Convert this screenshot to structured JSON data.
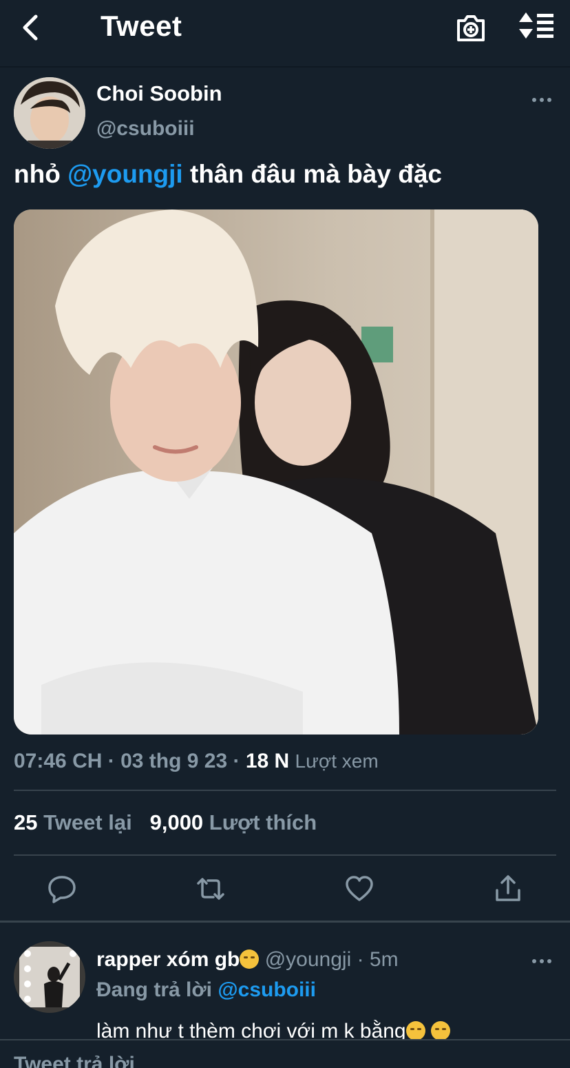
{
  "header": {
    "title": "Tweet",
    "back_icon": "chevron-left-icon",
    "camera_icon": "camera-plus-icon",
    "sort_icon": "sort-list-icon"
  },
  "tweet": {
    "author_name": "Choi Soobin",
    "author_handle": "@csuboiii",
    "text_before": "nhỏ ",
    "mention": "@youngji",
    "text_after": " thân đâu mà bày đặc",
    "time": "07:46 CH",
    "date": "03 thg 9 23",
    "views_count": "18 N",
    "views_label": "Lượt xem",
    "retweets_count": "25",
    "retweets_label": "Tweet lại",
    "likes_count": "9,000",
    "likes_label": "Lượt thích"
  },
  "actions": {
    "reply_icon": "reply-icon",
    "retweet_icon": "retweet-icon",
    "like_icon": "heart-icon",
    "share_icon": "share-icon"
  },
  "reply": {
    "author_name": "rapper xóm gb",
    "author_handle": "@youngji",
    "time": "5m",
    "replying_to_label": "Đang trả lời",
    "replying_to_handle": "@csuboiii",
    "text": "làm như t thèm chơi với m k bằng"
  },
  "bottom": {
    "label": "Tweet trả lời"
  },
  "colors": {
    "background": "#15202b",
    "accent": "#1d9bf0",
    "secondary_text": "#8899a6",
    "divider": "#38444d"
  }
}
